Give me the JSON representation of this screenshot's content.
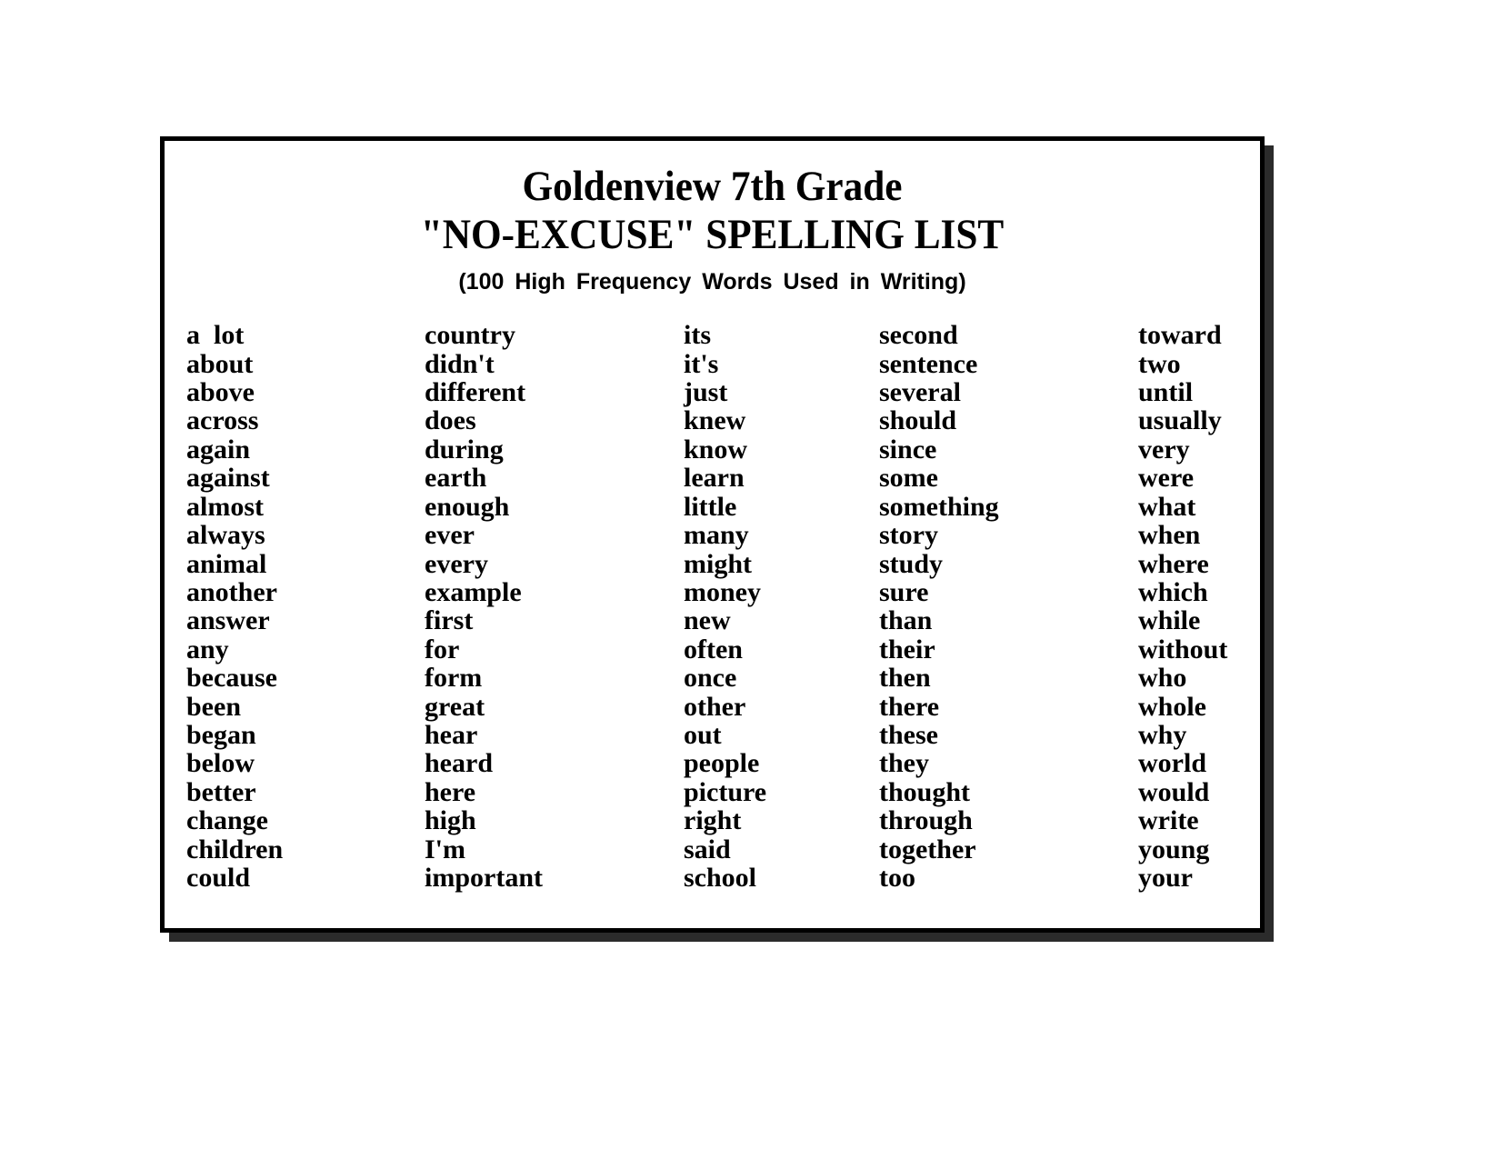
{
  "document": {
    "title_line_1": "Goldenview 7th Grade",
    "title_line_2": "\"NO-EXCUSE\" SPELLING LIST",
    "subtitle": "(100 High Frequency Words Used in Writing)",
    "border_color": "#000000",
    "background_color": "#ffffff",
    "text_color": "#000000"
  },
  "columns": [
    {
      "id": "column-1",
      "words": [
        "a  lot",
        "about",
        "above",
        "across",
        "again",
        "against",
        "almost",
        "always",
        "animal",
        "another",
        "answer",
        "any",
        "because",
        "been",
        "began",
        "below",
        "better",
        "change",
        "children",
        "could"
      ]
    },
    {
      "id": "column-2",
      "words": [
        "country",
        "didn't",
        "different",
        "does",
        "during",
        "earth",
        "enough",
        "ever",
        "every",
        "example",
        "first",
        "for",
        "form",
        "great",
        "hear",
        "heard",
        "here",
        "high",
        "I'm",
        "important"
      ]
    },
    {
      "id": "column-3",
      "words": [
        "its",
        "it's",
        "just",
        "knew",
        "know",
        "learn",
        "little",
        "many",
        "might",
        "money",
        "new",
        "often",
        "once",
        "other",
        "out",
        "people",
        "picture",
        "right",
        "said",
        "school"
      ]
    },
    {
      "id": "column-4",
      "words": [
        "second",
        "sentence",
        "several",
        "should",
        "since",
        "some",
        "something",
        "story",
        "study",
        "sure",
        "than",
        "their",
        "then",
        "there",
        "these",
        "they",
        "thought",
        "through",
        "together",
        "too"
      ]
    },
    {
      "id": "column-5",
      "words": [
        "toward",
        "two",
        "until",
        "usually",
        "very",
        "were",
        "what",
        "when",
        "where",
        "which",
        "while",
        "without",
        "who",
        "whole",
        "why",
        "world",
        "would",
        "write",
        "young",
        "your"
      ]
    }
  ]
}
